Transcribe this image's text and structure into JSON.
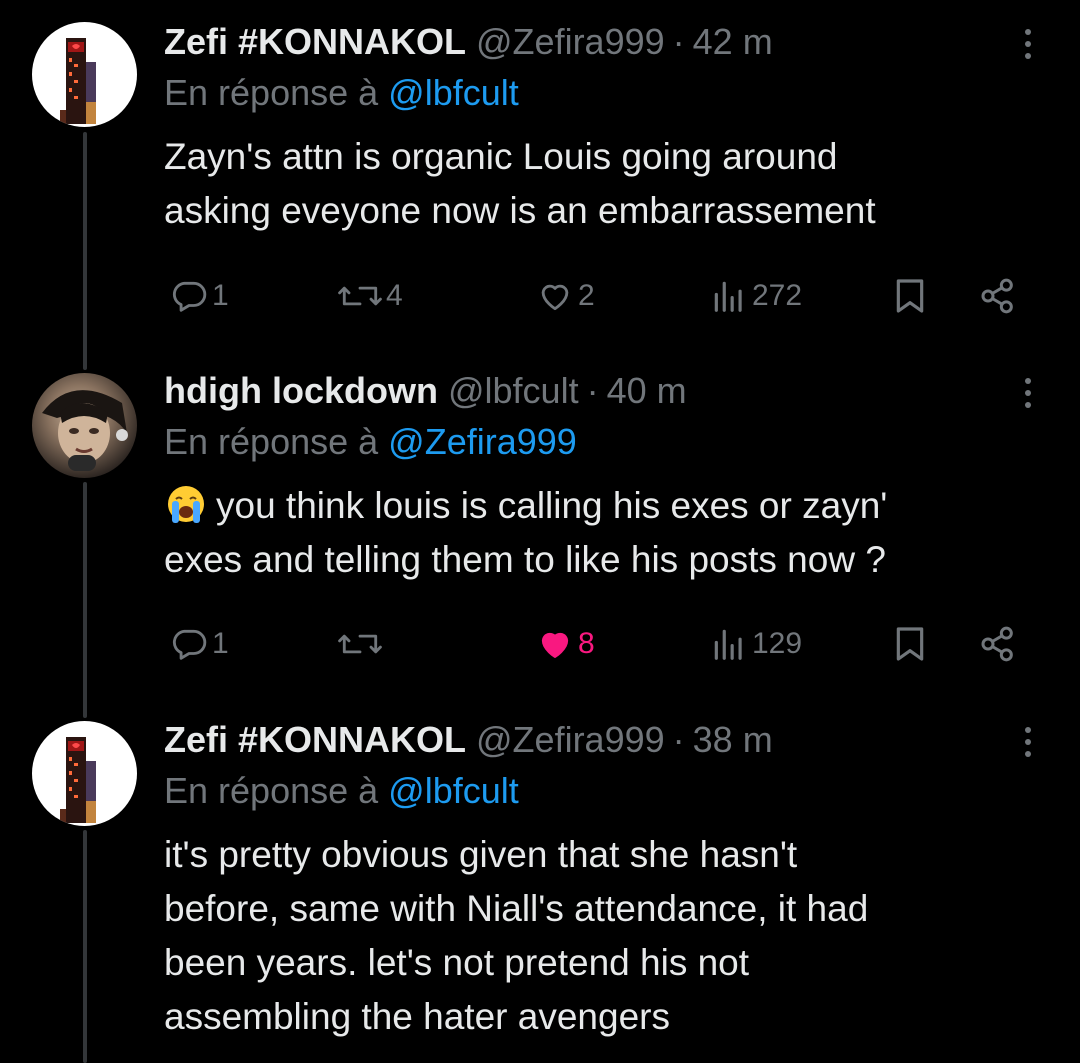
{
  "tweets": [
    {
      "name": "Zefi #KONNAKOL",
      "handle": "@Zefira999",
      "dot": "·",
      "time": "42 m",
      "reply_prefix": "En réponse à",
      "reply_to": "@lbfcult",
      "lines": [
        "Zayn's attn is organic Louis going around",
        "asking eveyone now is an embarrassement"
      ],
      "replies": "1",
      "reposts": "4",
      "likes": "2",
      "views": "272"
    },
    {
      "name": "hdigh lockdown",
      "handle": "@lbfcult",
      "dot": "·",
      "time": "40 m",
      "reply_prefix": "En réponse à",
      "reply_to": "@Zefira999",
      "lines": [
        "you think louis is calling his exes or zayn'",
        "exes and telling them to like his posts now ?"
      ],
      "replies": "1",
      "reposts": "",
      "likes": "8",
      "views": "129"
    },
    {
      "name": "Zefi #KONNAKOL",
      "handle": "@Zefira999",
      "dot": "·",
      "time": "38 m",
      "reply_prefix": "En réponse à",
      "reply_to": "@lbfcult",
      "lines": [
        "it's pretty obvious given that she hasn't",
        "before, same with Niall's attendance, it had",
        "been years. let's not pretend his not",
        "assembling the hater avengers"
      ]
    }
  ],
  "icons": {
    "reply": "speech-bubble-icon",
    "repost": "repost-arrows-icon",
    "like": "heart-icon",
    "views": "bar-chart-icon",
    "bookmark": "bookmark-icon",
    "share": "share-icon",
    "more": "more-vertical-icon",
    "emoji": "loudly-crying-face-emoji"
  },
  "colors": {
    "background": "#000000",
    "text": "#e7e9ea",
    "muted": "#71767b",
    "link": "#1d9bf0",
    "like_active": "#f91880",
    "thread_line": "#333639"
  }
}
